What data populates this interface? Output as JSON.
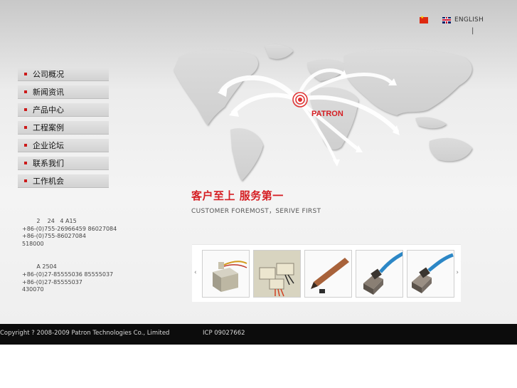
{
  "language_bar": {
    "chinese_flag_icon": "china-flag",
    "english_flag_icon": "uk-flag",
    "english_label": "ENGLISH",
    "separator": "|"
  },
  "map": {
    "marker_label": "PATRON"
  },
  "nav": {
    "items": [
      {
        "label": "公司概况"
      },
      {
        "label": "新闻资讯"
      },
      {
        "label": "产品中心"
      },
      {
        "label": "工程案例"
      },
      {
        "label": "企业论坛"
      },
      {
        "label": "联系我们"
      },
      {
        "label": "工作机会"
      }
    ]
  },
  "slogan": {
    "chinese": "客户至上  服务第一",
    "english": "CUSTOMER FOREMOST，SERIVE FIRST"
  },
  "contact": {
    "block1": [
      "        2    24   4 A15",
      "+86-(0)755-26966459 86027084",
      "+86-(0)755-86027084",
      "518000"
    ],
    "block2": [
      "        A 2504",
      "+86-(0)27-85555036 85555037",
      "+86-(0)27-85555037",
      "430070"
    ]
  },
  "products": {
    "prev_arrow": "‹",
    "next_arrow": "›",
    "items": [
      {
        "icon": "sensor-cube-product"
      },
      {
        "icon": "sensor-modules-product"
      },
      {
        "icon": "sensor-pen-product"
      },
      {
        "icon": "cable-sensor-product"
      },
      {
        "icon": "cable-sensor-product"
      }
    ]
  },
  "footer": {
    "copyright": "Copyright ? 2008-2009 Patron Technologies Co., Limited",
    "icp": "ICP 09027662"
  },
  "colors": {
    "accent_red": "#d51f24",
    "footer_bg": "#0c0c0c"
  }
}
